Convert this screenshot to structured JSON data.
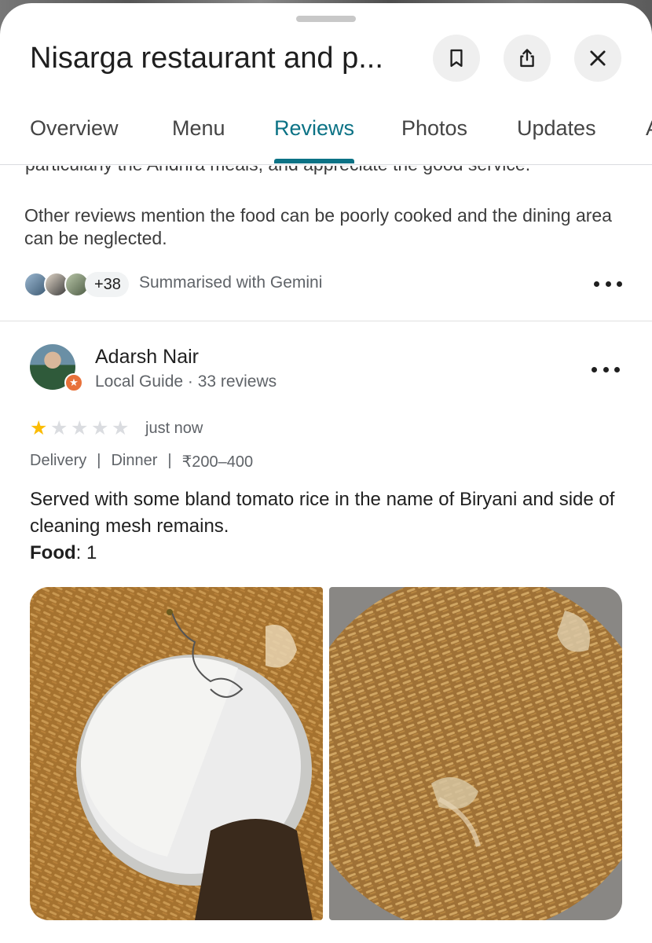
{
  "place": {
    "title": "Nisarga restaurant and p..."
  },
  "header_buttons": {
    "save_icon": "bookmark-icon",
    "share_icon": "share-icon",
    "close_icon": "close-icon"
  },
  "tabs": [
    {
      "label": "Overview",
      "active": false
    },
    {
      "label": "Menu",
      "active": false
    },
    {
      "label": "Reviews",
      "active": true
    },
    {
      "label": "Photos",
      "active": false
    },
    {
      "label": "Updates",
      "active": false
    },
    {
      "label": "A",
      "active": false
    }
  ],
  "summary": {
    "cut_line": "particularly the Andhra meals, and appreciate the good service.",
    "text": "Other reviews mention the food can be poorly cooked and the dining area can be neglected.",
    "more_count": "+38",
    "source": "Summarised with Gemini"
  },
  "review": {
    "author": "Adarsh Nair",
    "meta": "Local Guide · 33 reviews",
    "rating": 1,
    "max_rating": 5,
    "time": "just now",
    "tags": [
      "Delivery",
      "Dinner",
      "₹200–400"
    ],
    "text": "Served with some bland tomato rice in the name of Biryani and side of cleaning mesh remains.",
    "food_label": "Food",
    "food_score": ": 1"
  },
  "colors": {
    "accent": "#0b7285",
    "star": "#fbbc04",
    "local_guide_badge": "#e8713a"
  }
}
